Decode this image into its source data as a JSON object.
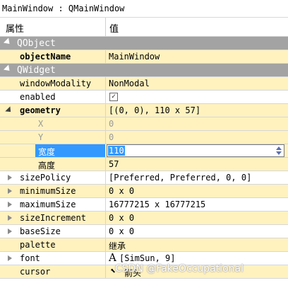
{
  "window": {
    "title": "MainWindow : QMainWindow"
  },
  "columns": {
    "property": "属性",
    "value": "值"
  },
  "groups": {
    "qobject": "QObject",
    "qwidget": "QWidget"
  },
  "rows": {
    "objectName": {
      "name": "objectName",
      "value": "MainWindow"
    },
    "windowModality": {
      "name": "windowModality",
      "value": "NonModal"
    },
    "enabled": {
      "name": "enabled",
      "checked": true
    },
    "geometry": {
      "name": "geometry",
      "value": "[(0, 0), 110 x 57]"
    },
    "x": {
      "name": "X",
      "value": "0"
    },
    "y": {
      "name": "Y",
      "value": "0"
    },
    "width": {
      "name": "宽度",
      "value": "110"
    },
    "height": {
      "name": "高度",
      "value": "57"
    },
    "sizePolicy": {
      "name": "sizePolicy",
      "value": "[Preferred, Preferred, 0, 0]"
    },
    "minimumSize": {
      "name": "minimumSize",
      "value": "0 x 0"
    },
    "maximumSize": {
      "name": "maximumSize",
      "value": "16777215 x 16777215"
    },
    "sizeIncrement": {
      "name": "sizeIncrement",
      "value": "0 x 0"
    },
    "baseSize": {
      "name": "baseSize",
      "value": "0 x 0"
    },
    "palette": {
      "name": "palette",
      "value": "继承"
    },
    "font": {
      "name": "font",
      "glyph": "A",
      "value": "[SimSun, 9]"
    },
    "cursor": {
      "name": "cursor",
      "value": "箭头"
    }
  },
  "watermark": "CSDN @FakeOccupational",
  "colors": {
    "group_bg": "#a3a3a3",
    "row_yellow": "#fff2bf",
    "selection": "#3399ff"
  },
  "icons": {
    "check": "checkmark-icon",
    "expand": "arrow-right-icon",
    "collapse": "arrow-down-icon",
    "spin": "spinbox-arrows-icon",
    "cursor": "arrow-cursor-icon"
  }
}
